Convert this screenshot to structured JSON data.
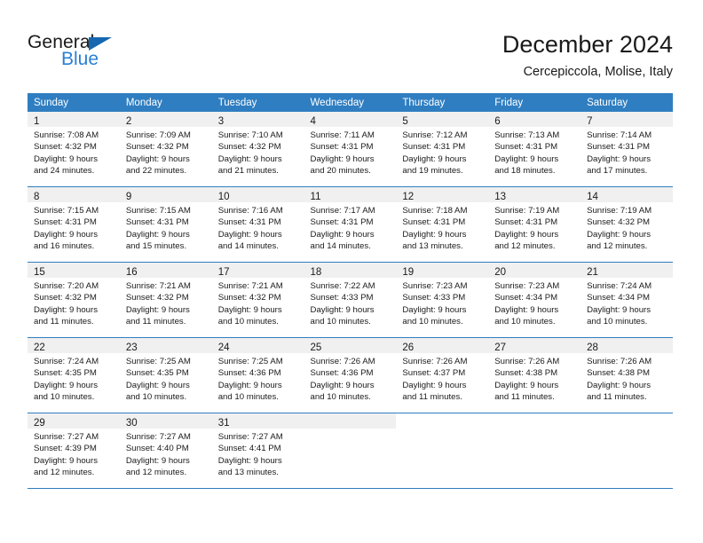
{
  "brand": {
    "name_part1": "General",
    "name_part2": "Blue",
    "triangle_color": "#1667b0",
    "blue_color": "#2a7fd4"
  },
  "header": {
    "title": "December 2024",
    "subtitle": "Cercepiccola, Molise, Italy"
  },
  "theme": {
    "header_bg": "#2f7ec1",
    "daynum_bg": "#f0f0f0",
    "rule_color": "#2f7ec1",
    "text_color": "#1a1a1a"
  },
  "weekday_headers": [
    "Sunday",
    "Monday",
    "Tuesday",
    "Wednesday",
    "Thursday",
    "Friday",
    "Saturday"
  ],
  "weeks": [
    [
      {
        "day": "1",
        "sunrise": "Sunrise: 7:08 AM",
        "sunset": "Sunset: 4:32 PM",
        "daylight1": "Daylight: 9 hours",
        "daylight2": "and 24 minutes."
      },
      {
        "day": "2",
        "sunrise": "Sunrise: 7:09 AM",
        "sunset": "Sunset: 4:32 PM",
        "daylight1": "Daylight: 9 hours",
        "daylight2": "and 22 minutes."
      },
      {
        "day": "3",
        "sunrise": "Sunrise: 7:10 AM",
        "sunset": "Sunset: 4:32 PM",
        "daylight1": "Daylight: 9 hours",
        "daylight2": "and 21 minutes."
      },
      {
        "day": "4",
        "sunrise": "Sunrise: 7:11 AM",
        "sunset": "Sunset: 4:31 PM",
        "daylight1": "Daylight: 9 hours",
        "daylight2": "and 20 minutes."
      },
      {
        "day": "5",
        "sunrise": "Sunrise: 7:12 AM",
        "sunset": "Sunset: 4:31 PM",
        "daylight1": "Daylight: 9 hours",
        "daylight2": "and 19 minutes."
      },
      {
        "day": "6",
        "sunrise": "Sunrise: 7:13 AM",
        "sunset": "Sunset: 4:31 PM",
        "daylight1": "Daylight: 9 hours",
        "daylight2": "and 18 minutes."
      },
      {
        "day": "7",
        "sunrise": "Sunrise: 7:14 AM",
        "sunset": "Sunset: 4:31 PM",
        "daylight1": "Daylight: 9 hours",
        "daylight2": "and 17 minutes."
      }
    ],
    [
      {
        "day": "8",
        "sunrise": "Sunrise: 7:15 AM",
        "sunset": "Sunset: 4:31 PM",
        "daylight1": "Daylight: 9 hours",
        "daylight2": "and 16 minutes."
      },
      {
        "day": "9",
        "sunrise": "Sunrise: 7:15 AM",
        "sunset": "Sunset: 4:31 PM",
        "daylight1": "Daylight: 9 hours",
        "daylight2": "and 15 minutes."
      },
      {
        "day": "10",
        "sunrise": "Sunrise: 7:16 AM",
        "sunset": "Sunset: 4:31 PM",
        "daylight1": "Daylight: 9 hours",
        "daylight2": "and 14 minutes."
      },
      {
        "day": "11",
        "sunrise": "Sunrise: 7:17 AM",
        "sunset": "Sunset: 4:31 PM",
        "daylight1": "Daylight: 9 hours",
        "daylight2": "and 14 minutes."
      },
      {
        "day": "12",
        "sunrise": "Sunrise: 7:18 AM",
        "sunset": "Sunset: 4:31 PM",
        "daylight1": "Daylight: 9 hours",
        "daylight2": "and 13 minutes."
      },
      {
        "day": "13",
        "sunrise": "Sunrise: 7:19 AM",
        "sunset": "Sunset: 4:31 PM",
        "daylight1": "Daylight: 9 hours",
        "daylight2": "and 12 minutes."
      },
      {
        "day": "14",
        "sunrise": "Sunrise: 7:19 AM",
        "sunset": "Sunset: 4:32 PM",
        "daylight1": "Daylight: 9 hours",
        "daylight2": "and 12 minutes."
      }
    ],
    [
      {
        "day": "15",
        "sunrise": "Sunrise: 7:20 AM",
        "sunset": "Sunset: 4:32 PM",
        "daylight1": "Daylight: 9 hours",
        "daylight2": "and 11 minutes."
      },
      {
        "day": "16",
        "sunrise": "Sunrise: 7:21 AM",
        "sunset": "Sunset: 4:32 PM",
        "daylight1": "Daylight: 9 hours",
        "daylight2": "and 11 minutes."
      },
      {
        "day": "17",
        "sunrise": "Sunrise: 7:21 AM",
        "sunset": "Sunset: 4:32 PM",
        "daylight1": "Daylight: 9 hours",
        "daylight2": "and 10 minutes."
      },
      {
        "day": "18",
        "sunrise": "Sunrise: 7:22 AM",
        "sunset": "Sunset: 4:33 PM",
        "daylight1": "Daylight: 9 hours",
        "daylight2": "and 10 minutes."
      },
      {
        "day": "19",
        "sunrise": "Sunrise: 7:23 AM",
        "sunset": "Sunset: 4:33 PM",
        "daylight1": "Daylight: 9 hours",
        "daylight2": "and 10 minutes."
      },
      {
        "day": "20",
        "sunrise": "Sunrise: 7:23 AM",
        "sunset": "Sunset: 4:34 PM",
        "daylight1": "Daylight: 9 hours",
        "daylight2": "and 10 minutes."
      },
      {
        "day": "21",
        "sunrise": "Sunrise: 7:24 AM",
        "sunset": "Sunset: 4:34 PM",
        "daylight1": "Daylight: 9 hours",
        "daylight2": "and 10 minutes."
      }
    ],
    [
      {
        "day": "22",
        "sunrise": "Sunrise: 7:24 AM",
        "sunset": "Sunset: 4:35 PM",
        "daylight1": "Daylight: 9 hours",
        "daylight2": "and 10 minutes."
      },
      {
        "day": "23",
        "sunrise": "Sunrise: 7:25 AM",
        "sunset": "Sunset: 4:35 PM",
        "daylight1": "Daylight: 9 hours",
        "daylight2": "and 10 minutes."
      },
      {
        "day": "24",
        "sunrise": "Sunrise: 7:25 AM",
        "sunset": "Sunset: 4:36 PM",
        "daylight1": "Daylight: 9 hours",
        "daylight2": "and 10 minutes."
      },
      {
        "day": "25",
        "sunrise": "Sunrise: 7:26 AM",
        "sunset": "Sunset: 4:36 PM",
        "daylight1": "Daylight: 9 hours",
        "daylight2": "and 10 minutes."
      },
      {
        "day": "26",
        "sunrise": "Sunrise: 7:26 AM",
        "sunset": "Sunset: 4:37 PM",
        "daylight1": "Daylight: 9 hours",
        "daylight2": "and 11 minutes."
      },
      {
        "day": "27",
        "sunrise": "Sunrise: 7:26 AM",
        "sunset": "Sunset: 4:38 PM",
        "daylight1": "Daylight: 9 hours",
        "daylight2": "and 11 minutes."
      },
      {
        "day": "28",
        "sunrise": "Sunrise: 7:26 AM",
        "sunset": "Sunset: 4:38 PM",
        "daylight1": "Daylight: 9 hours",
        "daylight2": "and 11 minutes."
      }
    ],
    [
      {
        "day": "29",
        "sunrise": "Sunrise: 7:27 AM",
        "sunset": "Sunset: 4:39 PM",
        "daylight1": "Daylight: 9 hours",
        "daylight2": "and 12 minutes."
      },
      {
        "day": "30",
        "sunrise": "Sunrise: 7:27 AM",
        "sunset": "Sunset: 4:40 PM",
        "daylight1": "Daylight: 9 hours",
        "daylight2": "and 12 minutes."
      },
      {
        "day": "31",
        "sunrise": "Sunrise: 7:27 AM",
        "sunset": "Sunset: 4:41 PM",
        "daylight1": "Daylight: 9 hours",
        "daylight2": "and 13 minutes."
      },
      {
        "day": "",
        "sunrise": "",
        "sunset": "",
        "daylight1": "",
        "daylight2": ""
      },
      {
        "day": "",
        "sunrise": "",
        "sunset": "",
        "daylight1": "",
        "daylight2": ""
      },
      {
        "day": "",
        "sunrise": "",
        "sunset": "",
        "daylight1": "",
        "daylight2": ""
      },
      {
        "day": "",
        "sunrise": "",
        "sunset": "",
        "daylight1": "",
        "daylight2": ""
      }
    ]
  ]
}
